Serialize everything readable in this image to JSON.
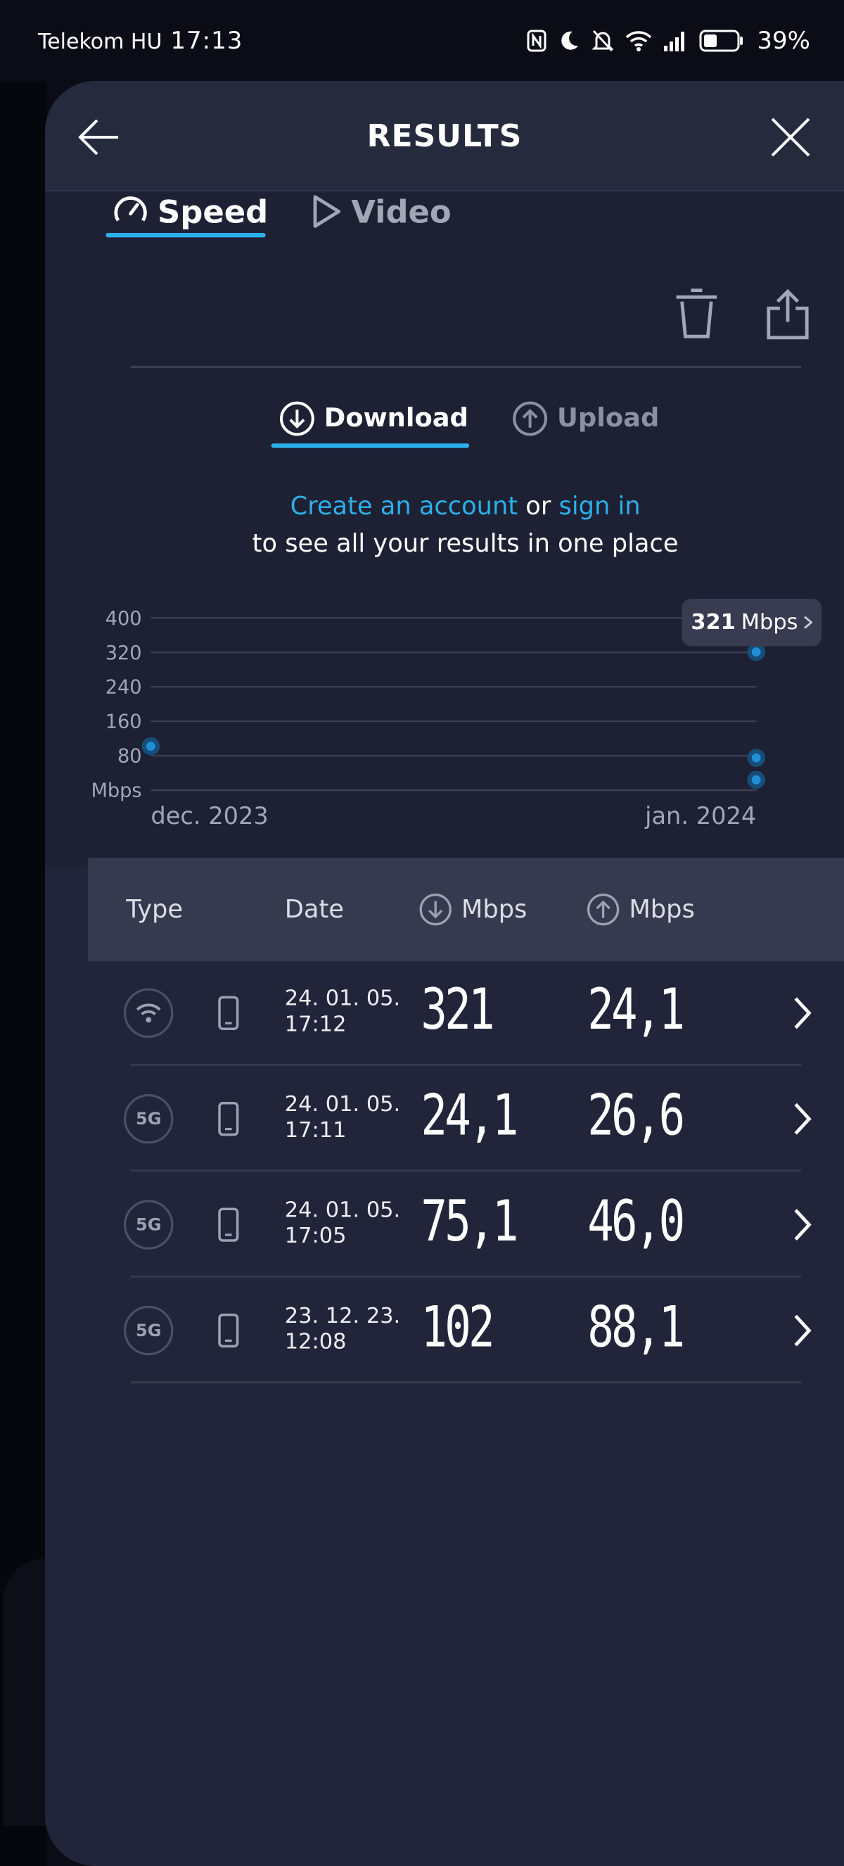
{
  "status_bar": {
    "carrier": "Telekom HU",
    "time": "17:13",
    "battery": "39%"
  },
  "header": {
    "title": "RESULTS"
  },
  "tabs": {
    "speed_label": "Speed",
    "video_label": "Video",
    "active": "Speed"
  },
  "subtabs": {
    "download_label": "Download",
    "upload_label": "Upload",
    "active": "Download"
  },
  "account_message": {
    "create_link": "Create an account",
    "or_text": " or ",
    "sign_in_link": "sign in",
    "line2": "to see all your results in one place"
  },
  "chart_data": {
    "type": "scatter",
    "title": "",
    "xlabel": "",
    "ylabel": "Mbps",
    "y_ticks": [
      "400",
      "320",
      "240",
      "160",
      "80"
    ],
    "ylim": [
      0,
      400
    ],
    "x_tick_labels": [
      "dec. 2023",
      "jan. 2024"
    ],
    "grid": true,
    "series": [
      {
        "points": [
          {
            "x": "dec. 2023",
            "y": 102
          },
          {
            "x": "jan. 2024",
            "y": 321
          },
          {
            "x": "jan. 2024",
            "y": 75.1
          },
          {
            "x": "jan. 2024",
            "y": 24.1
          }
        ]
      }
    ],
    "tooltip": {
      "value": "321",
      "unit": "Mbps"
    }
  },
  "table": {
    "headers": {
      "type": "Type",
      "date": "Date",
      "download": "Mbps",
      "upload": "Mbps"
    },
    "rows": [
      {
        "type": "wifi",
        "date_line1": "24. 01. 05.",
        "date_line2": "17:12",
        "download": "321",
        "upload": "24,1"
      },
      {
        "type": "5G",
        "date_line1": "24. 01. 05.",
        "date_line2": "17:11",
        "download": "24,1",
        "upload": "26,6"
      },
      {
        "type": "5G",
        "date_line1": "24. 01. 05.",
        "date_line2": "17:05",
        "download": "75,1",
        "upload": "46,0"
      },
      {
        "type": "5G",
        "date_line1": "23. 12. 23.",
        "date_line2": "12:08",
        "download": "102",
        "upload": "88,1"
      }
    ]
  },
  "colors": {
    "accent": "#2bb0ea",
    "sheet_bg": "#222539",
    "header_bg": "#262a3d",
    "table_header_bg": "#363a4f",
    "point_color": "#1f8fd6"
  }
}
